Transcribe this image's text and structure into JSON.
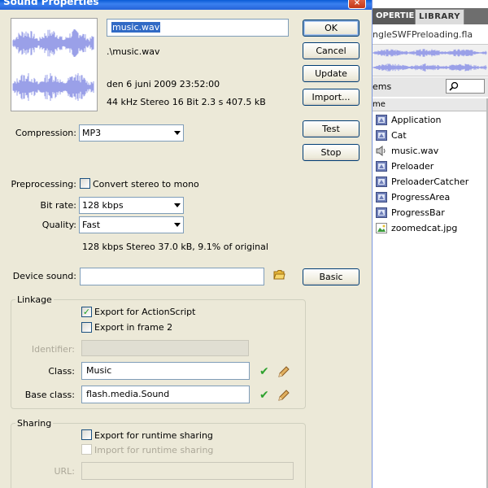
{
  "dialog": {
    "title": "Sound Properties",
    "close_glyph": "×",
    "name_value": "music.wav",
    "path": ".\\music.wav",
    "date": "den 6 juni 2009  23:52:00",
    "format": "44 kHz Stereo 16 Bit 2.3 s 407.5 kB",
    "buttons": {
      "ok": "OK",
      "cancel": "Cancel",
      "update": "Update",
      "import": "Import...",
      "test": "Test",
      "stop": "Stop",
      "basic": "Basic"
    },
    "compression": {
      "label": "Compression:",
      "value": "MP3"
    },
    "preprocessing": {
      "label": "Preprocessing:",
      "checkbox_label": "Convert stereo to mono",
      "checked": false
    },
    "bitrate": {
      "label": "Bit rate:",
      "value": "128 kbps"
    },
    "quality": {
      "label": "Quality:",
      "value": "Fast"
    },
    "summary": "128 kbps  Stereo 37.0 kB, 9.1% of original",
    "device_sound": {
      "label": "Device sound:",
      "value": ""
    },
    "linkage": {
      "title": "Linkage",
      "export_actionscript": {
        "label": "Export for ActionScript",
        "checked": true
      },
      "export_frame2": {
        "label": "Export in frame 2",
        "checked": false
      },
      "identifier_label": "Identifier:",
      "identifier_value": "",
      "class_label": "Class:",
      "class_value": "Music",
      "base_class_label": "Base class:",
      "base_class_value": "flash.media.Sound"
    },
    "sharing": {
      "title": "Sharing",
      "export_runtime": {
        "label": "Export for runtime sharing",
        "checked": false
      },
      "import_runtime": {
        "label": "Import for runtime sharing",
        "checked": false
      },
      "url_label": "URL:",
      "url_value": ""
    },
    "icons": {
      "check": "check-icon",
      "pencil": "pencil-icon",
      "folder": "folder-icon"
    }
  },
  "library": {
    "tabs": [
      "OPERTIES",
      "LIBRARY"
    ],
    "document": "ngleSWFPreloading.fla",
    "items_label": "ems",
    "name_header": "me",
    "items": [
      {
        "label": "Application",
        "icon": "movieclip-icon"
      },
      {
        "label": "Cat",
        "icon": "movieclip-icon"
      },
      {
        "label": "music.wav",
        "icon": "sound-icon"
      },
      {
        "label": "Preloader",
        "icon": "movieclip-icon"
      },
      {
        "label": "PreloaderCatcher",
        "icon": "movieclip-icon"
      },
      {
        "label": "ProgressArea",
        "icon": "movieclip-icon"
      },
      {
        "label": "ProgressBar",
        "icon": "movieclip-icon"
      },
      {
        "label": "zoomedcat.jpg",
        "icon": "bitmap-icon"
      }
    ]
  },
  "colors": {
    "waveform": "#9aa0e8",
    "selection": "#316ac5",
    "titlebar": "#0a5bd5",
    "panel_header": "#6e6e6e"
  }
}
